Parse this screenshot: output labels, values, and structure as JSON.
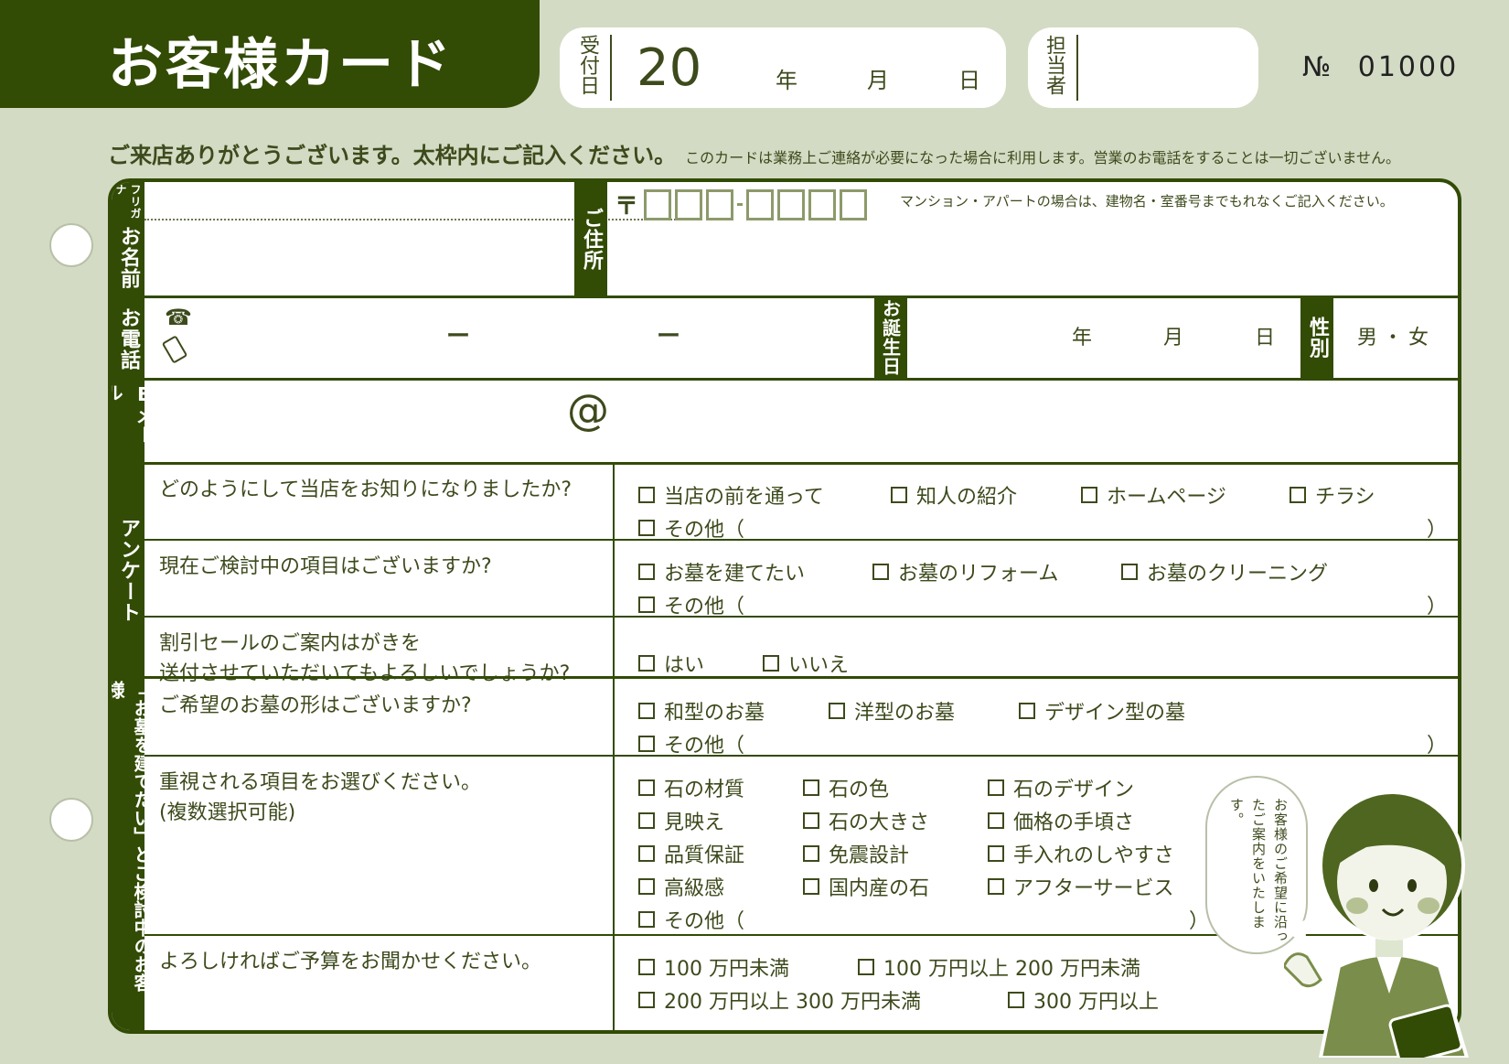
{
  "header": {
    "title": "お客様カード",
    "received_label": "受付日",
    "received_year_prefix": "20",
    "year": "年",
    "month": "月",
    "day": "日",
    "staff_label": "担当者",
    "number_label": "№",
    "number_value": "01000"
  },
  "intro": {
    "main": "ご来店ありがとうございます。太枠内にご記入ください。",
    "note": "このカードは業務上ご連絡が必要になった場合に利用します。営業のお電話をすることは一切ございません。"
  },
  "form": {
    "furigana": "フリガナ",
    "name_label": "お名前",
    "address_label": "ご住所",
    "postal_mark": "〒",
    "address_note": "マンション・アパートの場合は、建物名・室番号までもれなくご記入ください。",
    "phone_label": "お電話",
    "phone_icon": "telephone-icon",
    "mobile_icon": "mobile-phone-icon",
    "dash": "ー",
    "birthday_label": "お誕生日",
    "birth_year": "年",
    "birth_month": "月",
    "birth_day": "日",
    "gender_label": "性別",
    "gender_options": "男・女",
    "email_label": "Eメール",
    "at_mark": "@",
    "survey_label": "アンケート",
    "grave_label": "「お墓を建てたい」とご検討中のお客様"
  },
  "questions": [
    {
      "q": "どのようにして当店をお知りになりましたか?",
      "options": [
        "当店の前を通って",
        "知人の紹介",
        "ホームページ",
        "チラシ"
      ],
      "other": "その他（",
      "close": "）"
    },
    {
      "q": "現在ご検討中の項目はございますか?",
      "options": [
        "お墓を建てたい",
        "お墓のリフォーム",
        "お墓のクリーニング"
      ],
      "other": "その他（",
      "close": "）"
    },
    {
      "q1": "割引セールのご案内はがきを",
      "q2": "送付させていただいてもよろしいでしょうか?",
      "options": [
        "はい",
        "いいえ"
      ]
    },
    {
      "q": "ご希望のお墓の形はございますか?",
      "options": [
        "和型のお墓",
        "洋型のお墓",
        "デザイン型の墓"
      ],
      "other": "その他（",
      "close": "）"
    },
    {
      "q1": "重視される項目をお選びください。",
      "q2": "(複数選択可能)",
      "options": [
        "石の材質",
        "石の色",
        "石のデザイン",
        "見映え",
        "石の大きさ",
        "価格の手頃さ",
        "品質保証",
        "免震設計",
        "手入れのしやすさ",
        "高級感",
        "国内産の石",
        "アフターサービス"
      ],
      "other": "その他（",
      "close": "）"
    },
    {
      "q": "よろしければご予算をお聞かせください。",
      "options": [
        "100 万円未満",
        "100 万円以上 200 万円未満",
        "200 万円以上 300 万円未満",
        "300 万円以上"
      ]
    }
  ],
  "bubble": {
    "text": "お客様のご希望に沿ったご案内をいたします。"
  },
  "colors": {
    "dark_green": "#324b05",
    "background": "#d3dbc4",
    "text": "#3d4a1c"
  }
}
